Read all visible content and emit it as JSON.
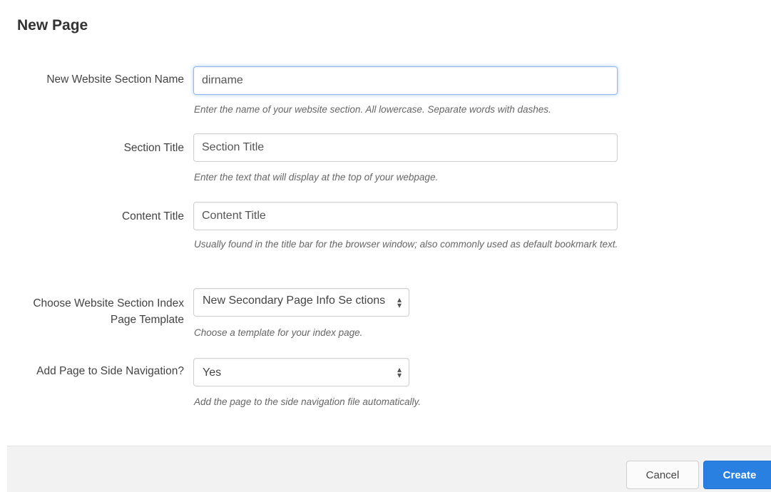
{
  "modal": {
    "title": "New Page"
  },
  "fields": {
    "section_name": {
      "label": "New Website Section Name",
      "value": "dirname",
      "help": "Enter the name of your website section. All lowercase. Separate words with dashes."
    },
    "section_title": {
      "label": "Section Title",
      "value": "Section Title",
      "help": "Enter the text that will display at the top of your webpage."
    },
    "content_title": {
      "label": "Content Title",
      "value": "Content Title",
      "help": "Usually found in the title bar for the browser window; also commonly used as default bookmark text."
    },
    "template": {
      "label": "Choose Website Section Index Page Template",
      "value": "New Secondary Page Info Se ctions",
      "help": "Choose a template for your index page."
    },
    "side_nav": {
      "label": "Add Page to Side Navigation?",
      "value": "Yes",
      "help": "Add the page to the side navigation file automatically."
    }
  },
  "footer": {
    "cancel_label": "Cancel",
    "create_label": "Create"
  },
  "icons": {
    "select_arrow": "select-updown-icon"
  },
  "colors": {
    "primary": "#2a80e0",
    "focus_border": "#8fb8ea",
    "footer_bg": "#f2f2f2"
  }
}
